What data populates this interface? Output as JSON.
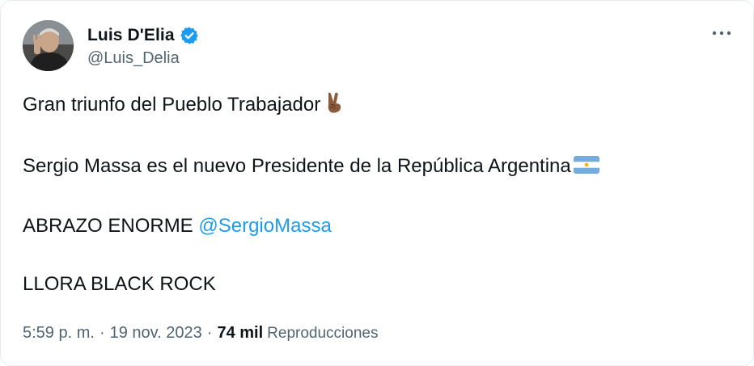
{
  "colors": {
    "text": "#0f1419",
    "secondary": "#536471",
    "link": "#1d9bf0",
    "verified": "#1d9bf0"
  },
  "tweet": {
    "author": {
      "display_name": "Luis D'Elia",
      "handle": "@Luis_Delia",
      "verified_icon": "verified-badge-icon"
    },
    "more_icon": "more-options-icon",
    "paragraphs": {
      "p1": "Gran triunfo del Pueblo Trabajador",
      "p1_emoji": "victory-hand-emoji",
      "p2": "Sergio Massa es el nuevo Presidente de la República Argentina",
      "p2_emoji": "argentina-flag-emoji",
      "p3_text": "ABRAZO ENORME ",
      "p3_mention": "@SergioMassa",
      "p4": "LLORA BLACK ROCK"
    },
    "meta": {
      "time": "5:59 p. m.",
      "date": "19 nov. 2023",
      "separator": "·",
      "views_count": "74 mil",
      "views_label": "Reproducciones"
    }
  }
}
